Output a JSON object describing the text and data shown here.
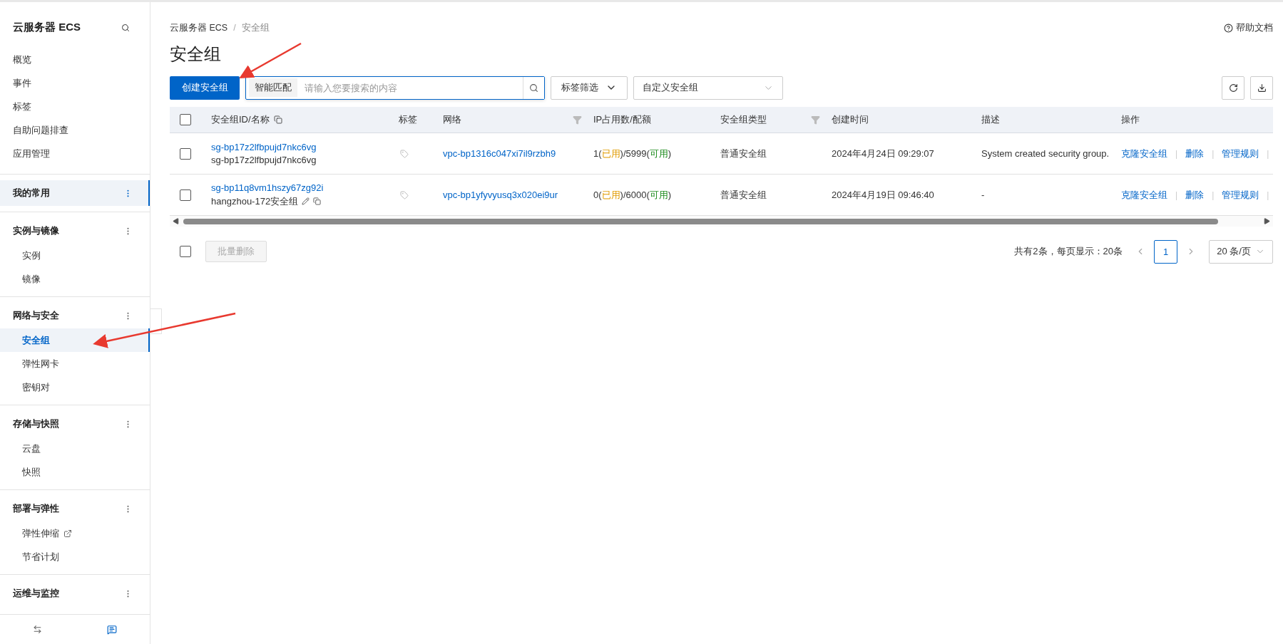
{
  "sidebar": {
    "title": "云服务器 ECS",
    "top_items": [
      {
        "label": "概览",
        "selected": false
      },
      {
        "label": "事件",
        "selected": false
      },
      {
        "label": "标签",
        "selected": false
      },
      {
        "label": "自助问题排查",
        "selected": false
      },
      {
        "label": "应用管理",
        "selected": false
      }
    ],
    "sections": [
      {
        "title": "我的常用",
        "selected": true
      },
      {
        "title": "实例与镜像",
        "selected": false,
        "items": [
          {
            "label": "实例",
            "selected": false,
            "external": false
          },
          {
            "label": "镜像",
            "selected": false,
            "external": false
          }
        ]
      },
      {
        "title": "网络与安全",
        "selected": false,
        "items": [
          {
            "label": "安全组",
            "selected": true,
            "external": false
          },
          {
            "label": "弹性网卡",
            "selected": false,
            "external": false
          },
          {
            "label": "密钥对",
            "selected": false,
            "external": false
          }
        ]
      },
      {
        "title": "存储与快照",
        "selected": false,
        "items": [
          {
            "label": "云盘",
            "selected": false,
            "external": false
          },
          {
            "label": "快照",
            "selected": false,
            "external": false
          }
        ]
      },
      {
        "title": "部署与弹性",
        "selected": false,
        "items": [
          {
            "label": "弹性伸缩",
            "selected": false,
            "external": true
          },
          {
            "label": "节省计划",
            "selected": false,
            "external": false
          }
        ]
      },
      {
        "title": "运维与监控",
        "selected": false
      }
    ]
  },
  "breadcrumb": [
    "云服务器 ECS",
    "安全组"
  ],
  "breadcrumb_separator": "/",
  "help_link": "帮助文档",
  "page_title": "安全组",
  "toolbar": {
    "create_button": "创建安全组",
    "search": {
      "mode": "智能匹配",
      "placeholder": "请输入您要搜索的内容"
    },
    "tag_filter": "标签筛选",
    "type_select": "自定义安全组"
  },
  "table": {
    "action_separator": "|",
    "columns": [
      "安全组ID/名称",
      "标签",
      "网络",
      "IP占用数/配额",
      "安全组类型",
      "创建时间",
      "描述",
      "操作"
    ],
    "header_checked": false,
    "rows": [
      {
        "checked": false,
        "id": "sg-bp17z2lfbpujd7nkc6vg",
        "name": "sg-bp17z2lfbpujd7nkc6vg",
        "name_tools": false,
        "network": "vpc-bp1316c047xi7il9rzbh9",
        "ip": [
          {
            "kind": "plain",
            "text": "1("
          },
          {
            "kind": "used",
            "text": "已用"
          },
          {
            "kind": "plain",
            "text": ")/5999("
          },
          {
            "kind": "free",
            "text": "可用"
          },
          {
            "kind": "plain",
            "text": ")"
          }
        ],
        "type": "普通安全组",
        "created": "2024年4月24日 09:29:07",
        "description": "System created security group.",
        "actions": [
          "克隆安全组",
          "删除",
          "管理规则"
        ]
      },
      {
        "checked": false,
        "id": "sg-bp11q8vm1hszy67zg92i",
        "name": "hangzhou-172安全组",
        "name_tools": true,
        "network": "vpc-bp1yfyvyusq3x020ei9ur",
        "ip": [
          {
            "kind": "plain",
            "text": "0("
          },
          {
            "kind": "used",
            "text": "已用"
          },
          {
            "kind": "plain",
            "text": ")/6000("
          },
          {
            "kind": "free",
            "text": "可用"
          },
          {
            "kind": "plain",
            "text": ")"
          }
        ],
        "type": "普通安全组",
        "created": "2024年4月19日 09:46:40",
        "description": "-",
        "actions": [
          "克隆安全组",
          "删除",
          "管理规则"
        ]
      }
    ]
  },
  "footer": {
    "checked": false,
    "bulk_delete": {
      "label": "批量删除",
      "disabled": true
    },
    "summary": "共有2条，每页显示：20条",
    "pages": [
      {
        "label": "1",
        "selected": true
      }
    ],
    "page_size": "20 条/页"
  }
}
